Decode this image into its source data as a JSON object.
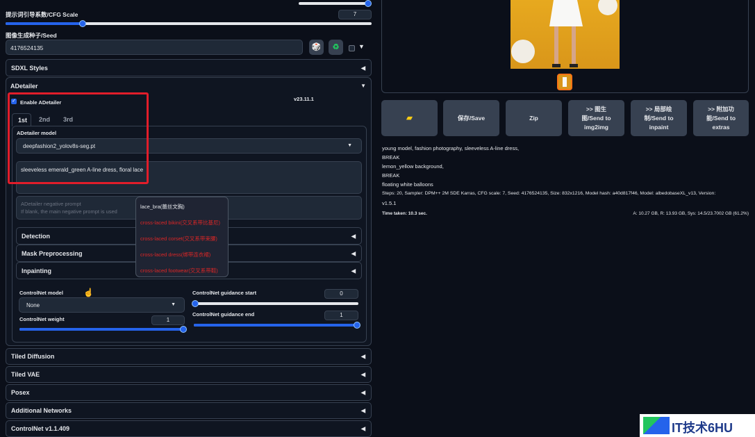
{
  "cfg": {
    "label": "提示词引导系数/CFG Scale",
    "value": "7",
    "fill_fraction": 0.21
  },
  "top_slider": {
    "fill_fraction": 0.96
  },
  "seed": {
    "label": "图像生成种子/Seed",
    "value": "4176524135"
  },
  "accordions": {
    "sdxl_styles": "SDXL Styles",
    "adetailer": "ADetailer",
    "tiled_diffusion": "Tiled Diffusion",
    "tiled_vae": "Tiled VAE",
    "posex": "Posex",
    "additional_networks": "Additional Networks",
    "controlnet": "ControlNet v1.1.409"
  },
  "adetailer": {
    "enable_label": "Enable ADetailer",
    "version": "v23.11.1",
    "tabs": [
      "1st",
      "2nd",
      "3rd"
    ],
    "model_label": "ADetailer model",
    "model_value": "deepfashion2_yolov8s-seg.pt",
    "prompt": "sleeveless emerald_green A-line dress, floral lace",
    "neg_placeholder_line1": "ADetailer negative prompt",
    "neg_placeholder_line2": "If blank, the main negative prompt is used",
    "sub_accordions": [
      "Detection",
      "Mask Preprocessing",
      "Inpainting"
    ],
    "controlnet_model_label": "ControlNet model",
    "controlnet_model_value": "None",
    "controlnet_weight_label": "ControlNet weight",
    "controlnet_weight_value": "1",
    "guidance_start_label": "ControlNet guidance start",
    "guidance_start_value": "0",
    "guidance_end_label": "ControlNet guidance end",
    "guidance_end_value": "1"
  },
  "autocomplete": {
    "items": [
      "lace_bra(蕾丝文胸)",
      "cross-laced bikini(交叉系带比基尼)",
      "cross-laced corset(交叉系带束腰)",
      "cross-laced dress(绑带连衣裙)",
      "cross-laced footwear(交叉系带鞋)"
    ],
    "item_colors": [
      "#e5e7eb",
      "#dc2626",
      "#dc2626",
      "#dc2626",
      "#dc2626"
    ]
  },
  "actions": {
    "folder_icon": "folder-icon",
    "save": "保存/Save",
    "zip": "Zip",
    "send_img2img": [
      ">> 图生",
      "图/Send to",
      "img2img"
    ],
    "send_inpaint": [
      ">> 局部绘",
      "制/Send to",
      "inpaint"
    ],
    "send_extras": [
      ">> 附加功",
      "能/Send to",
      "extras"
    ]
  },
  "generation_info": {
    "lines": [
      "young model, fashion photography, sleeveless A-line dress,",
      "BREAK",
      "lemon_yellow background,",
      "BREAK",
      "floating white balloons",
      "Steps: 20, Sampler: DPM++ 2M SDE Karras, CFG scale: 7, Seed: 4176524135, Size: 832x1216, Model hash: a40d817f46, Model: albedobaseXL_v13, Version:",
      "v1.5.1"
    ],
    "time_taken": "Time taken: 10.3 sec.",
    "vram": "A: 10.27 GB, R: 13.93 GB, Sys: 14.5/23.7002 GB (61.2%)"
  },
  "watermark": {
    "text": "IT技术6HU"
  },
  "colors": {
    "accent": "#2563eb",
    "highlight_box": "#e11d2a",
    "background": "#0b0f19"
  }
}
